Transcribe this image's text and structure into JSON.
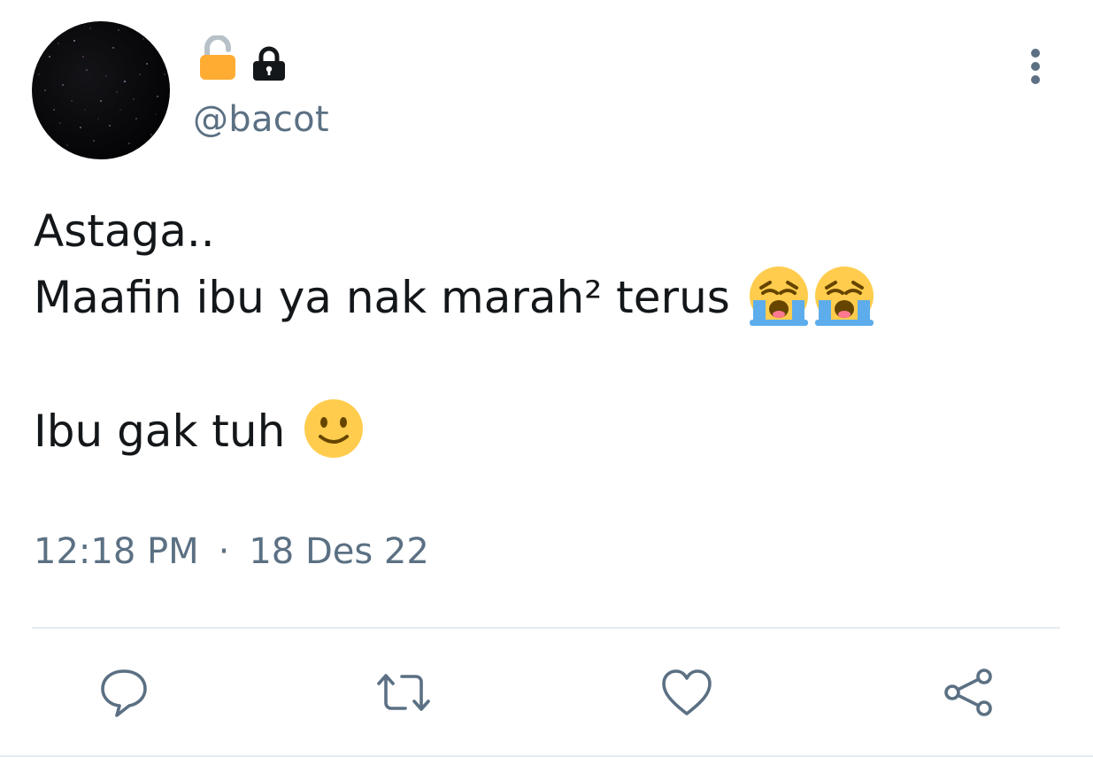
{
  "author": {
    "avatar_icon": "starry-night-avatar",
    "name_icons": [
      "open-lock-emoji",
      "lock-emoji"
    ],
    "handle": "@bacot"
  },
  "menu_icon": "more-vertical-icon",
  "tweet": {
    "line1": "Astaga..",
    "line2": "Maafin ibu ya nak marah² terus",
    "line2_emojis": [
      "loudly-crying-face",
      "loudly-crying-face"
    ],
    "line3": "Ibu gak tuh",
    "line3_emoji": "slightly-smiling-face"
  },
  "meta": {
    "time": "12:18 PM",
    "separator": "·",
    "date": "18 Des 22"
  },
  "actions": [
    {
      "icon": "reply-icon"
    },
    {
      "icon": "retweet-icon"
    },
    {
      "icon": "like-icon"
    },
    {
      "icon": "share-icon"
    }
  ],
  "colors": {
    "text": "#14171a",
    "secondary": "#5b7083",
    "divider": "#e6ecf0",
    "emoji_yellow": "#ffcc4d",
    "lock_gold": "#ffac33"
  }
}
